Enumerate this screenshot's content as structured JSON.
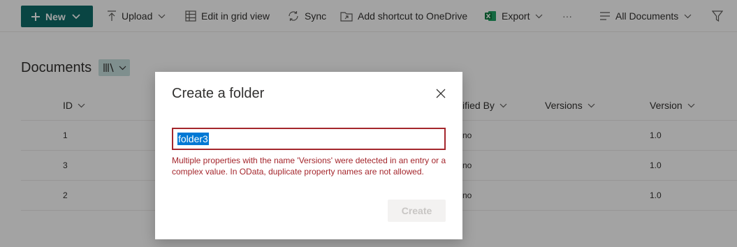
{
  "toolbar": {
    "new_label": "New",
    "upload_label": "Upload",
    "grid_label": "Edit in grid view",
    "sync_label": "Sync",
    "shortcut_label": "Add shortcut to OneDrive",
    "export_label": "Export",
    "more_label": "···",
    "view_label": "All Documents"
  },
  "library": {
    "title": "Documents"
  },
  "columns": {
    "id": "ID",
    "modified_by": "ified By",
    "versions": "Versions",
    "version": "Version"
  },
  "rows": [
    {
      "id": "1",
      "modified_by": "no",
      "version": "1.0"
    },
    {
      "id": "3",
      "modified_by": "no",
      "version": "1.0"
    },
    {
      "id": "2",
      "modified_by": "no",
      "version": "1.0"
    }
  ],
  "dialog": {
    "title": "Create a folder",
    "input_value": "folder3",
    "error_text": "Multiple properties with the name 'Versions' were detected in an entry or a complex value. In OData, duplicate property names are not allowed.",
    "create_label": "Create"
  },
  "colors": {
    "accent": "#0f6d6a",
    "error": "#a4262c",
    "selection": "#0078d4"
  }
}
